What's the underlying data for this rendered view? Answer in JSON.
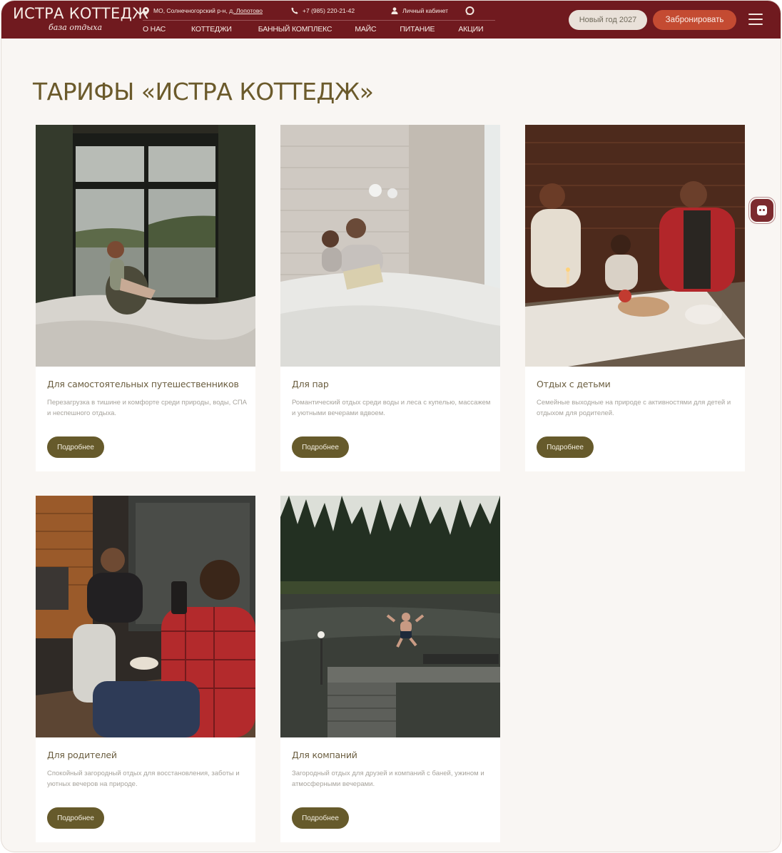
{
  "header": {
    "logo_text": "ИСТРА КОТТЕДЖ",
    "logo_subtext": "база отдыха",
    "address_prefix": "МО, Солнечногорский р-н,",
    "address_link": "д. Лопотово",
    "phone": "+7 (985) 220-21-42",
    "account": "Личный кабинет",
    "nav": [
      "О НАС",
      "КОТТЕДЖИ",
      "БАННЫЙ КОМПЛЕКС",
      "МАЙС",
      "ПИТАНИЕ",
      "АКЦИИ"
    ],
    "new_year_button": "Новый год 2027",
    "book_button": "Забронировать"
  },
  "page": {
    "title": "ТАРИФЫ «ИСТРА КОТТЕДЖ»"
  },
  "cards": [
    {
      "title": "Для самостоятельных путешественников",
      "description": "Перезагрузка в тишине и комфорте среди природы, воды, СПА и неспешного отдыха.",
      "button": "Подробнее"
    },
    {
      "title": "Для пар",
      "description": "Романтический отдых среди воды и леса с купелью, массажем и уютными вечерами вдвоем.",
      "button": "Подробнее"
    },
    {
      "title": "Отдых с детьми",
      "description": "Семейные выходные на природе с активностями для детей и отдыхом для родителей.",
      "button": "Подробнее"
    },
    {
      "title": "Для родителей",
      "description": "Спокойный загородный отдых для восстановления, заботы и уютных вечеров на природе.",
      "button": "Подробнее"
    },
    {
      "title": "Для компаний",
      "description": "Загородный отдых для друзей и компаний с баней, ужином и атмосферными вечерами.",
      "button": "Подробнее"
    }
  ],
  "icons": {
    "location": "location-pin-icon",
    "phone": "phone-icon",
    "account": "user-icon",
    "messenger": "chat-bubble-icon",
    "menu": "hamburger-menu-icon",
    "chat_widget": "chat-widget-icon"
  },
  "colors": {
    "header_bg": "#701a1f",
    "book_button": "#c44b32",
    "title_text": "#6b5a2b",
    "card_button": "#665a2b",
    "page_bg": "#f9f6f3"
  }
}
